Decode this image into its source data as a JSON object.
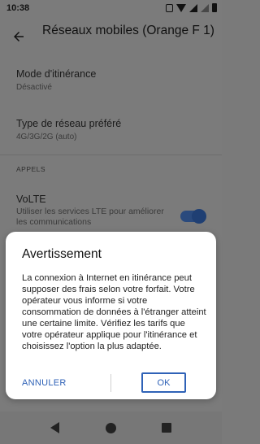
{
  "status_bar": {
    "time": "10:38",
    "icons": [
      "sim-card-icon",
      "wifi-icon",
      "signal-icon",
      "signal-hollow-icon",
      "battery-icon"
    ]
  },
  "app_bar": {
    "title": "Réseaux mobiles (Orange F 1)",
    "back_icon": "arrow-back-icon"
  },
  "settings": {
    "roaming": {
      "title": "Mode d'itinérance",
      "summary": "Désactivé"
    },
    "network_type": {
      "title": "Type de réseau préféré",
      "summary": "4G/3G/2G (auto)"
    },
    "section_calls": "APPELS",
    "volte": {
      "title": "VoLTE",
      "summary": "Utiliser les services LTE pour améliorer les communications",
      "enabled": true
    }
  },
  "dialog": {
    "title": "Avertissement",
    "body": "La connexion à Internet en itinérance peut supposer des frais selon votre forfait. Votre opérateur vous informe si votre consommation de données à l'étranger atteint une certaine limite. Vérifiez les tarifs que votre opérateur applique pour l'itinérance et choisissez l'option la plus adaptée.",
    "cancel_label": "ANNULER",
    "ok_label": "OK"
  },
  "nav_bar": {
    "icons": [
      "nav-back-icon",
      "nav-home-icon",
      "nav-recents-icon"
    ]
  },
  "colors": {
    "accent": "#2f62b7",
    "scrim_background": "#7b7b7b",
    "dialog_background": "#ffffff"
  }
}
